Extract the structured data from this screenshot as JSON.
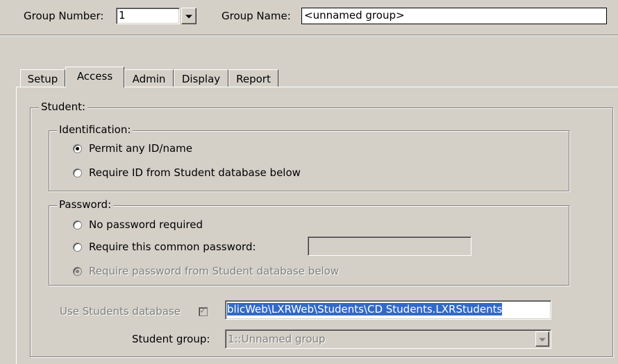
{
  "header": {
    "group_number_label": "Group Number:",
    "group_number_value": "1",
    "group_name_label": "Group Name:",
    "group_name_value": "<unnamed group>"
  },
  "tabs": [
    {
      "label": "Setup",
      "active": false
    },
    {
      "label": "Access",
      "active": true
    },
    {
      "label": "Admin",
      "active": false
    },
    {
      "label": "Display",
      "active": false
    },
    {
      "label": "Report",
      "active": false
    }
  ],
  "student_section": {
    "legend": "Student:",
    "identification": {
      "legend": "Identification:",
      "options": [
        {
          "label": "Permit any ID/name",
          "selected": true,
          "enabled": true
        },
        {
          "label": "Require ID from Student database below",
          "selected": false,
          "enabled": true
        }
      ]
    },
    "password": {
      "legend": "Password:",
      "options": [
        {
          "label": "No password required",
          "selected": false,
          "enabled": true
        },
        {
          "label": "Require this common password:",
          "selected": false,
          "enabled": true
        },
        {
          "label": "Require password from Student database below",
          "selected": true,
          "enabled": false
        }
      ],
      "common_password_value": ""
    },
    "use_students_database_label": "Use Students database",
    "use_students_database_checked": true,
    "students_database_path": "blicWeb\\LXRWeb\\Students\\CD Students.LXRStudents",
    "student_group_label": "Student group:",
    "student_group_value": "1::Unnamed group"
  },
  "colors": {
    "background": "#d4d0c8",
    "selection": "#316ac5"
  }
}
